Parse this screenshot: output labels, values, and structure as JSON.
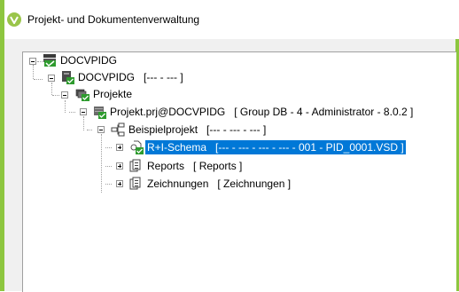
{
  "window": {
    "title": "Projekt- und Dokumentenverwaltung"
  },
  "tree": {
    "root": {
      "name": "DOCVPIDG"
    },
    "server": {
      "name": "DOCVPIDG",
      "info": "[---  - --- ]"
    },
    "projects": {
      "name": "Projekte"
    },
    "project": {
      "name": "Projekt.prj@DOCVPIDG",
      "info": "[ Group DB - 4 - Administrator - 8.0.2 ]"
    },
    "example": {
      "name": "Beispielprojekt",
      "info": "[--- - --- - --- ]"
    },
    "children": [
      {
        "name": "R+I-Schema",
        "info": "[--- - --- - --- - ---  - 001 - PID_0001.VSD ]"
      },
      {
        "name": "Reports",
        "info": "[ Reports ]"
      },
      {
        "name": "Zeichnungen",
        "info": "[ Zeichnungen ]"
      }
    ]
  },
  "colors": {
    "accent": "#8dc63f",
    "selection": "#0078d7"
  }
}
